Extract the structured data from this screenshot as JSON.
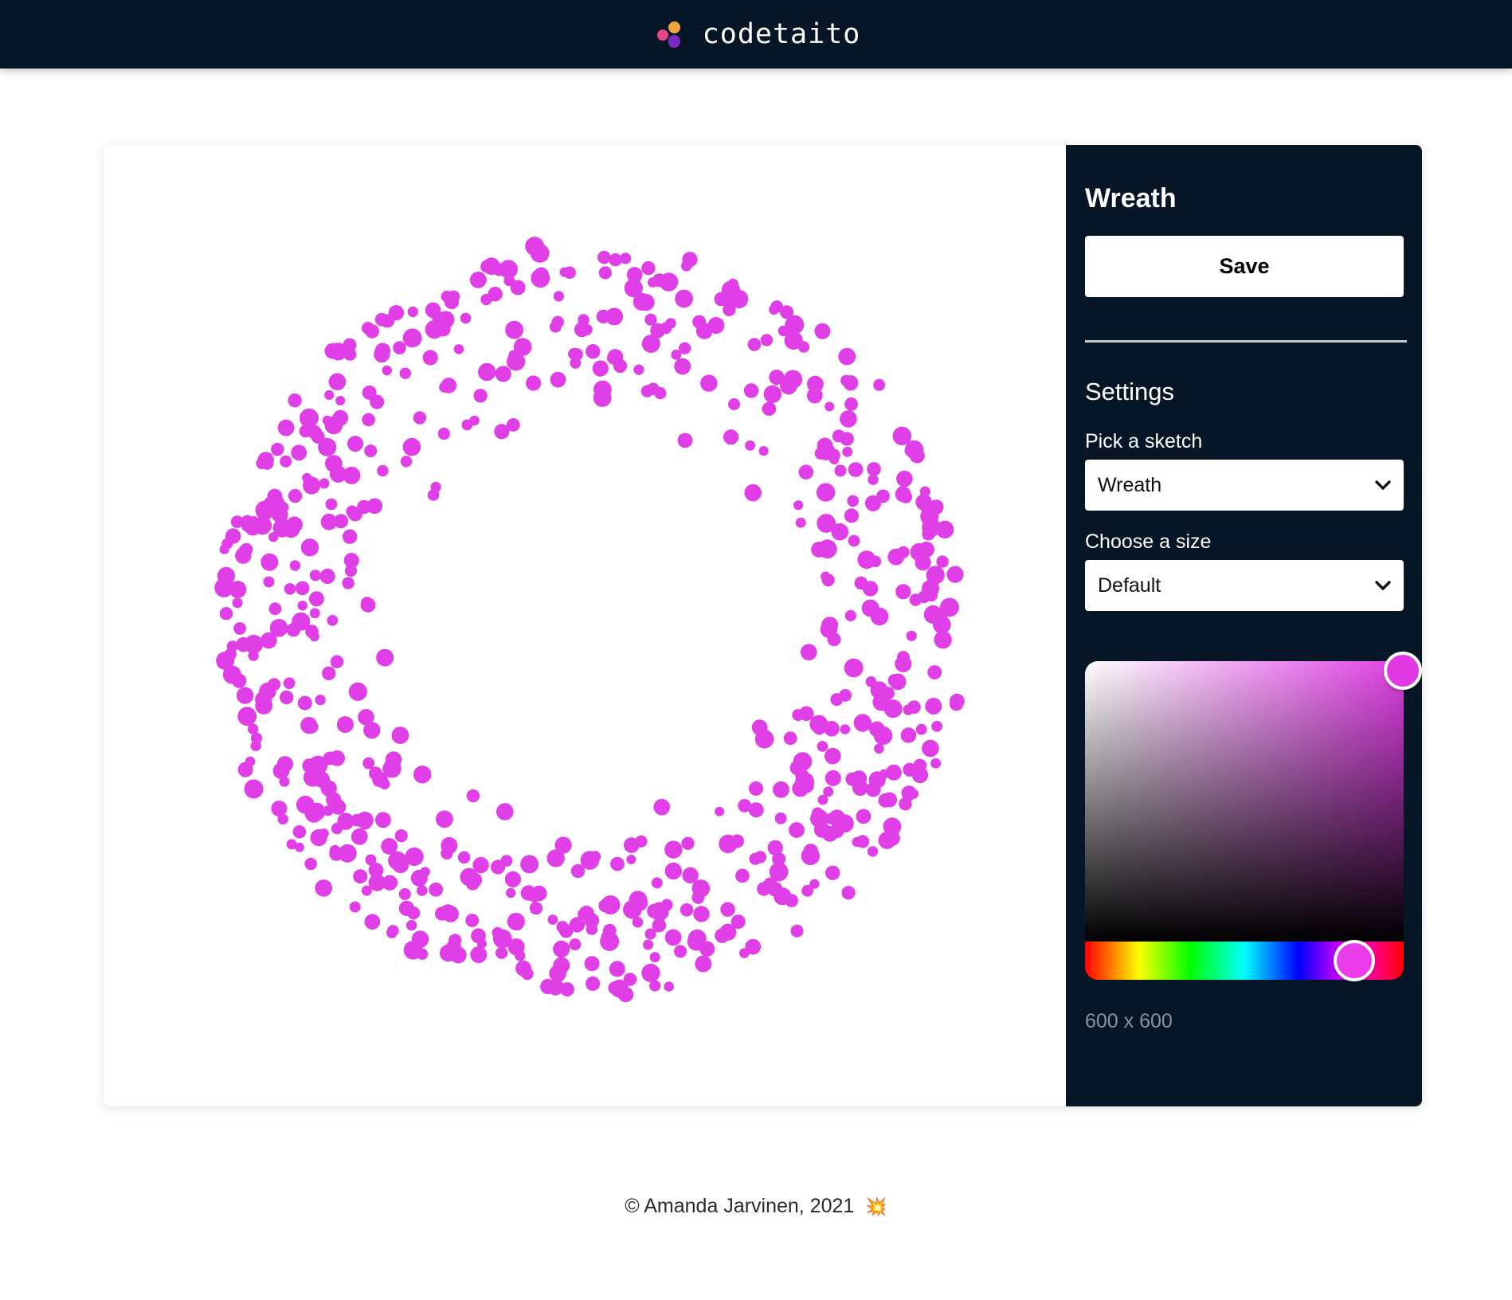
{
  "header": {
    "brand": "codetaito",
    "logo_colors": [
      "#f1a33e",
      "#e8468a",
      "#7a2bc0"
    ],
    "background": "#071627"
  },
  "sketch": {
    "name": "Wreath",
    "dot_color": "#e03ee6",
    "dot_count": 650,
    "canvas_size_label": "600 x 600"
  },
  "panel": {
    "title": "Wreath",
    "save_label": "Save",
    "settings_title": "Settings",
    "pick_sketch_label": "Pick a sketch",
    "pick_sketch_value": "Wreath",
    "choose_size_label": "Choose a size",
    "choose_size_value": "Default",
    "color_picker": {
      "selected_color": "#e03ee6",
      "saturation_percent": 100,
      "brightness_percent": 97,
      "hue_degrees": 298
    },
    "size_readout": "600 x 600"
  },
  "footer": {
    "copyright": "© Amanda Jarvinen, 2021",
    "emoji": "💥"
  }
}
